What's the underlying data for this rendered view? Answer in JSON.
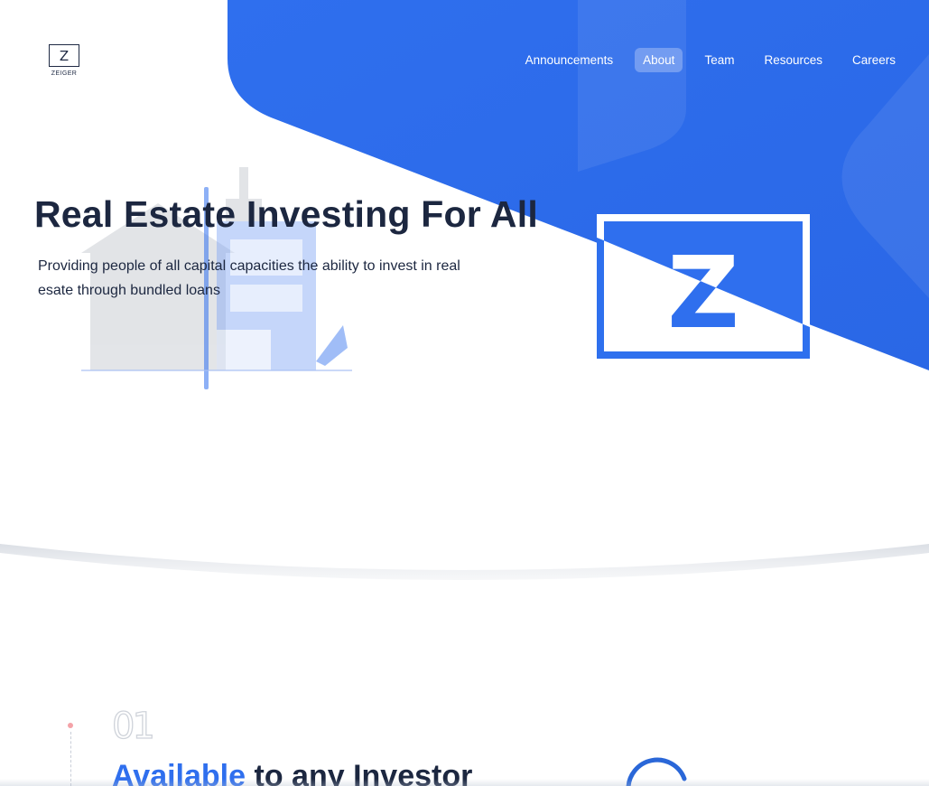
{
  "brand": {
    "logo_letter": "Z",
    "logo_name": "ZEIGER"
  },
  "nav": {
    "items": [
      {
        "label": "Announcements",
        "active": false
      },
      {
        "label": "About",
        "active": true
      },
      {
        "label": "Team",
        "active": false
      },
      {
        "label": "Resources",
        "active": false
      },
      {
        "label": "Careers",
        "active": false
      }
    ]
  },
  "hero": {
    "title": "Real Estate Investing For All",
    "subtitle": "Providing people of all capital capacities the ability to invest in real esate through bundled loans",
    "emblem_letter": "Z"
  },
  "section": {
    "number": "01",
    "heading_accent": "Available",
    "heading_rest": " to any Investor"
  },
  "colors": {
    "accent": "#2f6fee",
    "navy": "#1c2740",
    "timeline_dot": "#f4a3a8"
  },
  "icons": [
    "zeiger-logo-icon",
    "building-illustration-icon",
    "z-emblem-icon",
    "loading-spinner-icon"
  ]
}
